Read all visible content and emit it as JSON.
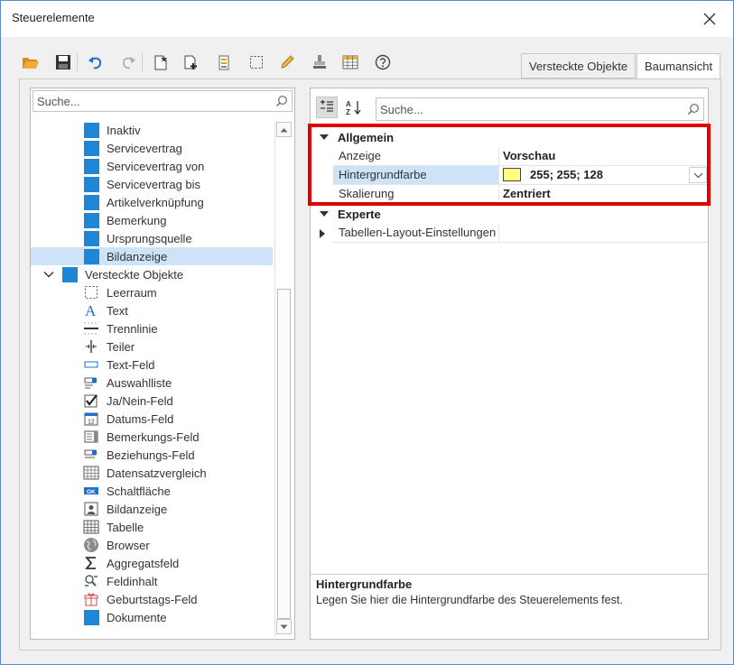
{
  "window": {
    "title": "Steuerelemente"
  },
  "toolbar": {
    "buttons": [
      {
        "icon": "open-folder-icon"
      },
      {
        "icon": "save-icon"
      },
      {
        "icon": "undo-icon"
      },
      {
        "icon": "redo-icon"
      },
      {
        "icon": "new-document-icon"
      },
      {
        "icon": "add-page-icon"
      },
      {
        "icon": "checklist-icon"
      },
      {
        "icon": "selection-icon"
      },
      {
        "icon": "edit-pencil-icon"
      },
      {
        "icon": "stamp-icon"
      },
      {
        "icon": "table-grid-icon"
      },
      {
        "icon": "help-icon"
      }
    ]
  },
  "tabs": [
    {
      "label": "Versteckte Objekte",
      "active": false
    },
    {
      "label": "Baumansicht",
      "active": true
    }
  ],
  "left_search": {
    "placeholder": "Suche..."
  },
  "tree": {
    "items": [
      {
        "label": "Inaktiv",
        "icon": "blue-square-icon"
      },
      {
        "label": "Servicevertrag",
        "icon": "blue-square-icon"
      },
      {
        "label": "Servicevertrag von",
        "icon": "blue-square-icon"
      },
      {
        "label": "Servicevertrag bis",
        "icon": "blue-square-icon"
      },
      {
        "label": "Artikelverknüpfung",
        "icon": "blue-square-icon"
      },
      {
        "label": "Bemerkung",
        "icon": "blue-square-icon"
      },
      {
        "label": "Ursprungsquelle",
        "icon": "blue-square-icon"
      },
      {
        "label": "Bildanzeige",
        "icon": "blue-square-icon",
        "selected": true
      },
      {
        "label": "Versteckte Objekte",
        "icon": "blue-square-icon",
        "group": true,
        "expanded": true
      },
      {
        "label": "Leerraum",
        "icon": "empty-space-icon"
      },
      {
        "label": "Text",
        "icon": "text-icon"
      },
      {
        "label": "Trennlinie",
        "icon": "separator-line-icon"
      },
      {
        "label": "Teiler",
        "icon": "splitter-icon"
      },
      {
        "label": "Text-Feld",
        "icon": "text-field-icon"
      },
      {
        "label": "Auswahlliste",
        "icon": "dropdown-list-icon"
      },
      {
        "label": "Ja/Nein-Feld",
        "icon": "checkbox-icon"
      },
      {
        "label": "Datums-Feld",
        "icon": "calendar-icon"
      },
      {
        "label": "Bemerkungs-Feld",
        "icon": "memo-field-icon"
      },
      {
        "label": "Beziehungs-Feld",
        "icon": "relation-field-icon"
      },
      {
        "label": "Datensatzvergleich",
        "icon": "record-compare-icon"
      },
      {
        "label": "Schaltfläche",
        "icon": "button-ok-icon"
      },
      {
        "label": "Bildanzeige",
        "icon": "image-display-icon"
      },
      {
        "label": "Tabelle",
        "icon": "table-icon"
      },
      {
        "label": "Browser",
        "icon": "globe-icon"
      },
      {
        "label": "Aggregatsfeld",
        "icon": "sigma-icon"
      },
      {
        "label": "Feldinhalt",
        "icon": "field-content-icon"
      },
      {
        "label": "Geburtstags-Feld",
        "icon": "gift-icon"
      },
      {
        "label": "Dokumente",
        "icon": "blue-square-icon"
      }
    ]
  },
  "properties": {
    "search_placeholder": "Suche...",
    "categories": [
      {
        "label": "Allgemein",
        "expanded": true,
        "rows": [
          {
            "name": "Anzeige",
            "value": "Vorschau"
          },
          {
            "name": "Hintergrundfarbe",
            "value": "255; 255; 128",
            "color": "#ffff80",
            "selected": true
          },
          {
            "name": "Skalierung",
            "value": "Zentriert"
          }
        ]
      },
      {
        "label": "Experte",
        "expanded": true,
        "rows": [
          {
            "name": "Tabellen-Layout-Einstellungen",
            "value": "",
            "collapsed": true
          }
        ]
      }
    ],
    "description": {
      "title": "Hintergrundfarbe",
      "text": "Legen Sie hier die Hintergrundfarbe des Steuerelements fest."
    }
  },
  "colors": {
    "accent": "#1e86d6",
    "selection": "#cde3f7",
    "highlight": "#e00000"
  }
}
